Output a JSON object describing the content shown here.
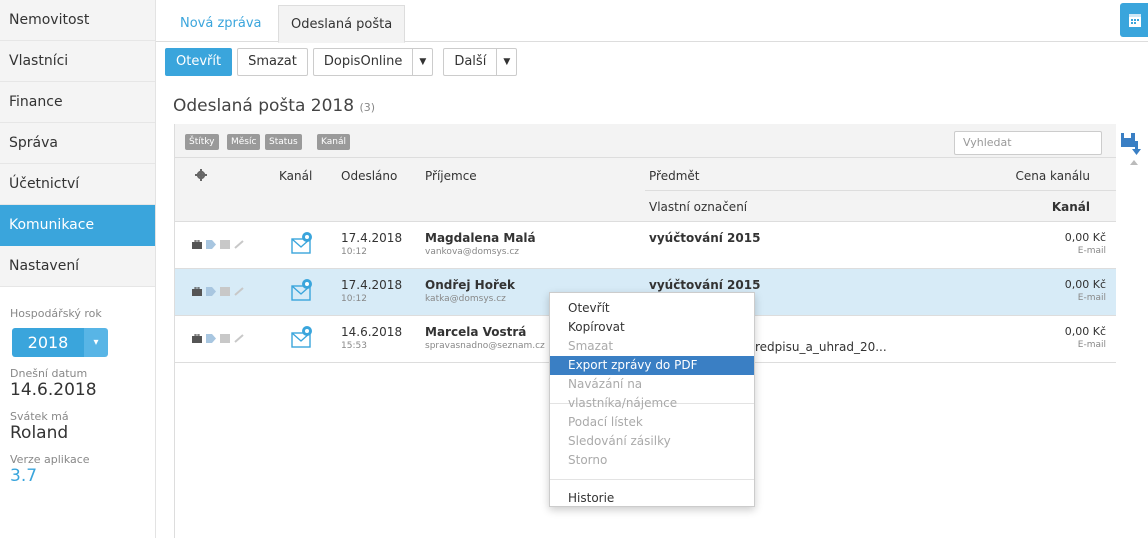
{
  "sidebar": {
    "items": [
      "Nemovitost",
      "Vlastníci",
      "Finance",
      "Správa",
      "Účetnictví",
      "Komunikace",
      "Nastavení"
    ],
    "active_index": 5,
    "fiscal_year_label": "Hospodářský rok",
    "fiscal_year_value": "2018",
    "today_label": "Dnešní datum",
    "today_value": "14.6.2018",
    "nameday_label": "Svátek má",
    "nameday_value": "Roland",
    "version_label": "Verze aplikace",
    "version_value": "3.7"
  },
  "tabs": {
    "new_message": "Nová zpráva",
    "sent_mail": "Odeslaná pošta"
  },
  "toolbar": {
    "open": "Otevřít",
    "delete": "Smazat",
    "dopis_online": "DopisOnline",
    "more": "Další"
  },
  "page": {
    "title": "Odeslaná pošta 2018",
    "count": "(3)"
  },
  "filters": {
    "chips": [
      "Štítky",
      "Měsíc",
      "Status",
      "Kanál"
    ],
    "search_placeholder": "Vyhledat"
  },
  "table": {
    "headers": {
      "channel": "Kanál",
      "sent": "Odesláno",
      "recipient": "Příjemce",
      "subject": "Předmět",
      "custom_label": "Vlastní označení",
      "channel_price": "Cena kanálu",
      "channel2": "Kanál"
    },
    "rows": [
      {
        "date": "17.4.2018",
        "time": "10:12",
        "name": "Magdalena Malá",
        "email": "vankova@domsys.cz",
        "subject": "vyúčtování 2015",
        "price": "0,00 Kč",
        "channel": "E-mail"
      },
      {
        "date": "17.4.2018",
        "time": "10:12",
        "name": "Ondřej Hořek",
        "email": "katka@domsys.cz",
        "subject": "vyúčtování 2015",
        "price": "0,00 Kč",
        "channel": "E-mail"
      },
      {
        "date": "14.6.2018",
        "time": "15:53",
        "name": "Marcela Vostrá",
        "email": "spravasnadno@seznam.cz",
        "subject": "redpisu_a_uhrad_20...",
        "price": "0,00 Kč",
        "channel": "E-mail"
      }
    ]
  },
  "context_menu": {
    "items": [
      {
        "label": "Otevřít",
        "state": "normal"
      },
      {
        "label": "Kopírovat",
        "state": "normal"
      },
      {
        "label": "Smazat",
        "state": "disabled"
      },
      {
        "label": "Export zprávy do PDF",
        "state": "highlighted"
      },
      {
        "label": "Navázání na vlastníka/nájemce",
        "state": "disabled"
      },
      {
        "label": "Podací lístek",
        "state": "disabled"
      },
      {
        "label": "Sledování zásilky",
        "state": "disabled"
      },
      {
        "label": "Storno",
        "state": "disabled"
      },
      {
        "label": "Historie",
        "state": "normal"
      }
    ]
  },
  "colors": {
    "accent": "#3aa5dc",
    "selected_row": "#d7ebf7",
    "menu_highlight": "#3a7fc4"
  }
}
